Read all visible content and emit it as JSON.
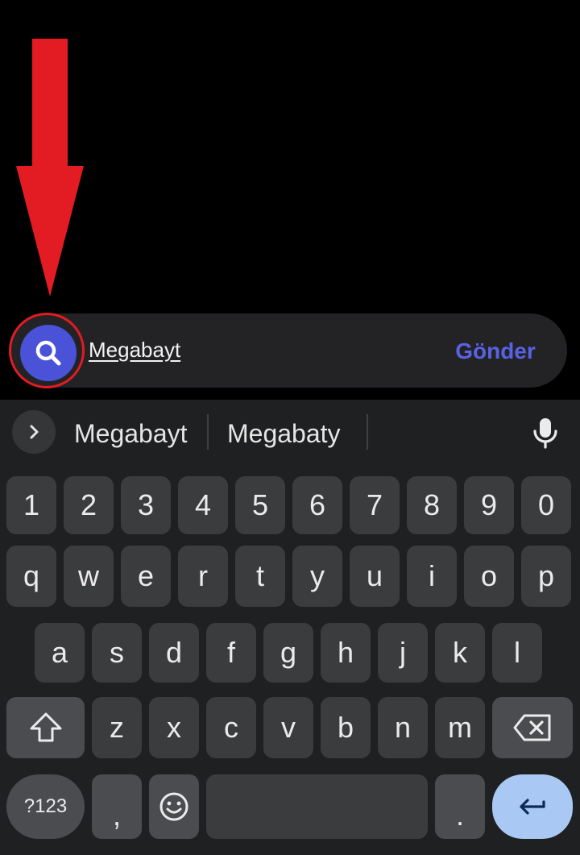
{
  "compose": {
    "text": "Megabayt",
    "send_label": "Gönder",
    "search_icon": "search-icon"
  },
  "suggestions": {
    "expand_icon": "chevron-right-icon",
    "items": [
      "Megabayt",
      "Megabaty"
    ],
    "mic_icon": "microphone-icon"
  },
  "keyboard": {
    "row_numbers": [
      "1",
      "2",
      "3",
      "4",
      "5",
      "6",
      "7",
      "8",
      "9",
      "0"
    ],
    "row_top": [
      "q",
      "w",
      "e",
      "r",
      "t",
      "y",
      "u",
      "i",
      "o",
      "p"
    ],
    "row_middle": [
      "a",
      "s",
      "d",
      "f",
      "g",
      "h",
      "j",
      "k",
      "l"
    ],
    "row_bottom": [
      "z",
      "x",
      "c",
      "v",
      "b",
      "n",
      "m"
    ],
    "symbols_label": "?123",
    "comma_label": ",",
    "period_label": ".",
    "shift_icon": "shift-icon",
    "backspace_icon": "backspace-icon",
    "emoji_icon": "emoji-icon",
    "enter_icon": "enter-icon"
  },
  "colors": {
    "accent": "#4a52d8",
    "send_text": "#5a62e4",
    "annotation_red": "#e31b23",
    "enter_key": "#a9c8f4"
  }
}
